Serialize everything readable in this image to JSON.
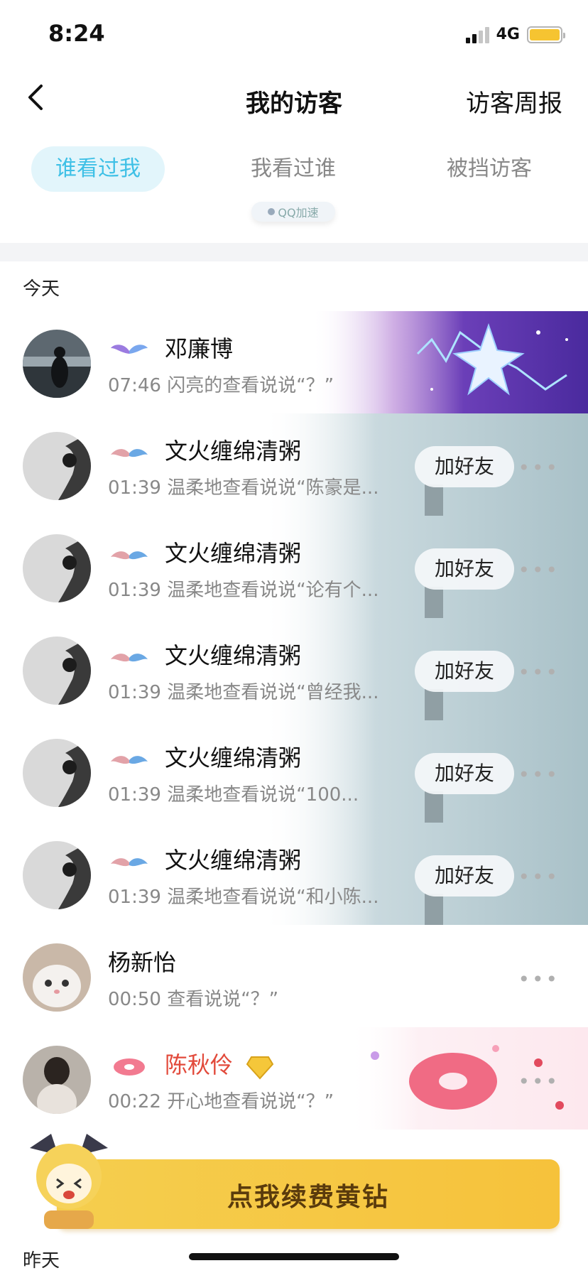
{
  "status": {
    "time": "8:24",
    "network": "4G"
  },
  "nav": {
    "title": "我的访客",
    "weekly_report": "访客周报"
  },
  "tabs": [
    {
      "label": "谁看过我",
      "active": true
    },
    {
      "label": "我看过谁",
      "active": false
    },
    {
      "label": "被挡访客",
      "active": false
    }
  ],
  "speed_badge": "QQ加速",
  "sections": {
    "today": "今天",
    "yesterday": "昨天"
  },
  "visitors": [
    {
      "name": "邓廉博",
      "desc": "07:46 闪亮的查看说说“？”",
      "vip_icon": "wings-icon",
      "add_friend": false
    },
    {
      "name": "文火缠绵清粥",
      "desc": "01:39 温柔地查看说说“陈豪是...",
      "vip_icon": "mustache-icon",
      "add_friend": true,
      "add_label": "加好友"
    },
    {
      "name": "文火缠绵清粥",
      "desc": "01:39 温柔地查看说说“论有个...",
      "vip_icon": "mustache-icon",
      "add_friend": true,
      "add_label": "加好友"
    },
    {
      "name": "文火缠绵清粥",
      "desc": "01:39 温柔地查看说说“曾经我...",
      "vip_icon": "mustache-icon",
      "add_friend": true,
      "add_label": "加好友"
    },
    {
      "name": "文火缠绵清粥",
      "desc": "01:39 温柔地查看说说“100...",
      "vip_icon": "mustache-icon",
      "add_friend": true,
      "add_label": "加好友"
    },
    {
      "name": "文火缠绵清粥",
      "desc": "01:39 温柔地查看说说“和小陈...",
      "vip_icon": "mustache-icon",
      "add_friend": true,
      "add_label": "加好友"
    },
    {
      "name": "杨新怡",
      "desc": "00:50 查看说说“？”",
      "vip_icon": "",
      "add_friend": false
    },
    {
      "name": "陈秋伶",
      "desc": "00:22 开心地查看说说“？”",
      "vip_icon": "donut-icon",
      "add_friend": false
    }
  ],
  "renew_banner": {
    "label": "点我续费黄钻"
  },
  "colors": {
    "accent": "#3ec0e6",
    "tab_active_bg": "#e2f5fb",
    "vip_name": "#e24a3b",
    "banner": "#f6c23b"
  }
}
